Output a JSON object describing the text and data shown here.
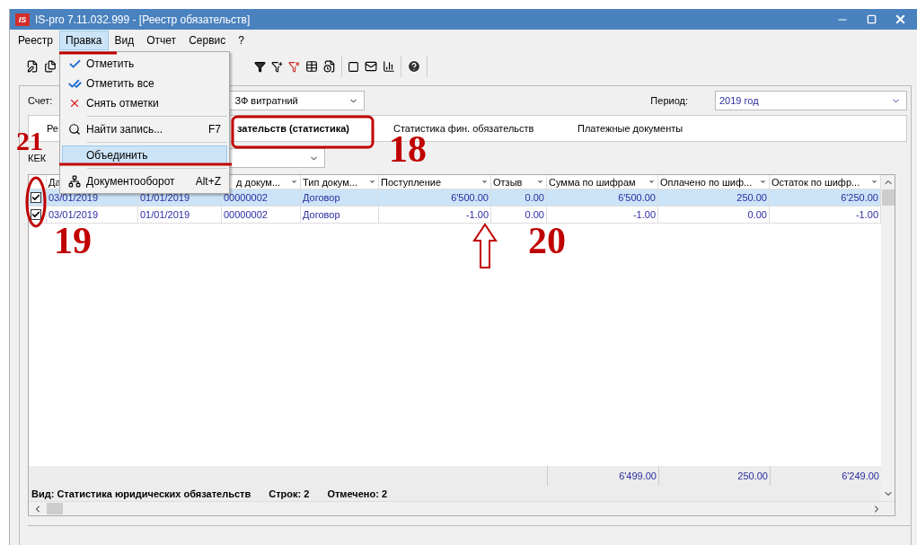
{
  "window": {
    "logo": "IS",
    "title": "IS-pro 7.11.032.999 - [Реестр обязательств]"
  },
  "menu_bar": [
    {
      "label": "Реестр",
      "selected": false
    },
    {
      "label": "Правка",
      "selected": true
    },
    {
      "label": "Вид",
      "selected": false
    },
    {
      "label": "Отчет",
      "selected": false
    },
    {
      "label": "Сервис",
      "selected": false
    },
    {
      "label": "?",
      "selected": false
    }
  ],
  "open_menu": {
    "items": [
      {
        "kind": "item",
        "label": "Отметить",
        "selected": false
      },
      {
        "kind": "item",
        "label": "Отметить все",
        "selected": false
      },
      {
        "kind": "item",
        "label": "Снять отметки",
        "selected": false
      },
      {
        "kind": "separator"
      },
      {
        "kind": "item",
        "label": "Найти запись...",
        "shortcut": "F7",
        "selected": false
      },
      {
        "kind": "separator"
      },
      {
        "kind": "item",
        "label": "Объединить",
        "selected": true
      },
      {
        "kind": "separator"
      },
      {
        "kind": "item",
        "label": "Документооборот",
        "shortcut": "Alt+Z",
        "selected": false
      }
    ]
  },
  "account": {
    "label": "Счет:",
    "value": "ЗФ витратний"
  },
  "period": {
    "label": "Период:",
    "value": "2019 год"
  },
  "tabs": [
    {
      "label": "Ре",
      "selected": false
    },
    {
      "label": "зательств (статистика)",
      "selected": true
    },
    {
      "label": "Статистика фин. обязательств",
      "selected": false
    },
    {
      "label": "Платежные документы",
      "selected": false
    }
  ],
  "kekv": {
    "label": "КЕК"
  },
  "table": {
    "columns": [
      {
        "label": "Да"
      },
      {},
      {
        "label": "д докум..."
      },
      {
        "label": "Тип докум..."
      },
      {
        "label": "Поступление"
      },
      {
        "label": "Отзыв"
      },
      {
        "label": "Сумма по шифрам"
      },
      {
        "label": "Оплачено по шиф..."
      },
      {
        "label": "Остаток по шифр..."
      }
    ],
    "rows": [
      {
        "checked": true,
        "selected": true,
        "cells": [
          "03/01/2019",
          "01/01/2019",
          "00000002",
          "Договор",
          "6'500.00",
          "0.00",
          "6'500.00",
          "250.00",
          "6'250.00"
        ]
      },
      {
        "checked": true,
        "selected": false,
        "cells": [
          "03/01/2019",
          "01/01/2019",
          "00000002",
          "Договор",
          "-1.00",
          "0.00",
          "-1.00",
          "0.00",
          "-1.00"
        ]
      }
    ],
    "totals": [
      "6'499.00",
      "250.00",
      "6'249.00"
    ]
  },
  "status": {
    "view": "Вид: Статистика юридических обязательств",
    "rows": "Строк: 2",
    "marked": "Отмечено: 2"
  },
  "annotations": [
    {
      "text": "21"
    },
    {
      "text": "18"
    },
    {
      "text": "19"
    },
    {
      "text": "20"
    }
  ]
}
